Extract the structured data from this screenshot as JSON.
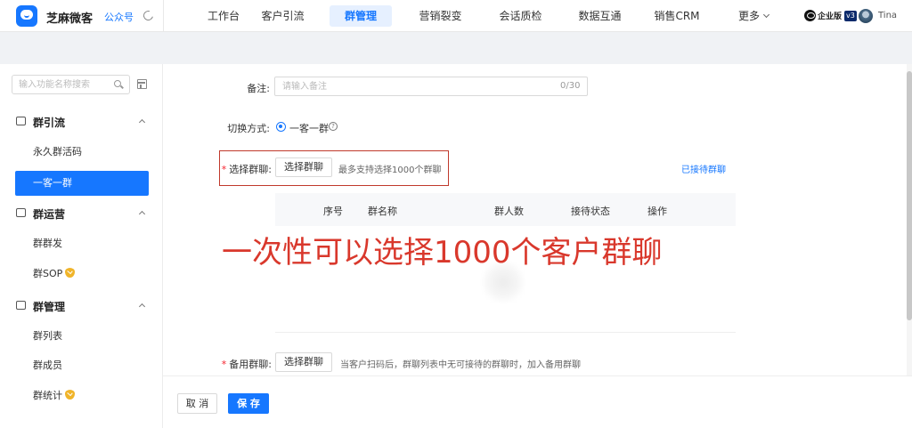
{
  "topbar": {
    "brand": "芝麻微客",
    "official_account": "公众号",
    "nav": [
      {
        "label": "工作台",
        "active": false
      },
      {
        "label": "客户引流",
        "active": false
      },
      {
        "label": "群管理",
        "active": true
      },
      {
        "label": "营销裂变",
        "active": false
      },
      {
        "label": "会话质检",
        "active": false
      },
      {
        "label": "数据互通",
        "active": false
      },
      {
        "label": "销售CRM",
        "active": false
      },
      {
        "label": "更多",
        "active": false
      }
    ],
    "edition": "企业版",
    "version": "v3",
    "username": "Tina"
  },
  "sidebar": {
    "search_placeholder": "输入功能名称搜索",
    "groups": [
      {
        "label": "群引流",
        "items": [
          {
            "label": "永久群活码",
            "active": false,
            "vip": false
          },
          {
            "label": "一客一群",
            "active": true,
            "vip": false
          }
        ]
      },
      {
        "label": "群运营",
        "items": [
          {
            "label": "群群发",
            "active": false,
            "vip": false
          },
          {
            "label": "群SOP",
            "active": false,
            "vip": true
          }
        ]
      },
      {
        "label": "群管理",
        "items": [
          {
            "label": "群列表",
            "active": false,
            "vip": false
          },
          {
            "label": "群成员",
            "active": false,
            "vip": false
          },
          {
            "label": "群统计",
            "active": false,
            "vip": true
          }
        ]
      }
    ]
  },
  "form": {
    "remark_label": "备注:",
    "remark_placeholder": "请输入备注",
    "remark_counter": "0/30",
    "switch_label": "切换方式:",
    "switch_option": "一客一群",
    "select_group_label": "选择群聊:",
    "select_group_button": "选择群聊",
    "select_group_hint": "最多支持选择1000个群聊",
    "reception_link": "已接待群聊",
    "table_headers": [
      "序号",
      "群名称",
      "群人数",
      "接待状态",
      "操作"
    ],
    "annotation": "一次性可以选择1000个客户群聊",
    "backup_label": "备用群聊:",
    "backup_button": "选择群聊",
    "backup_hint": "当客户扫码后，群聊列表中无可接待的群聊时，加入备用群聊"
  },
  "footer": {
    "cancel": "取 消",
    "save": "保 存"
  },
  "colors": {
    "accent": "#1677ff",
    "annotation": "#d9382c",
    "required": "#f5222d"
  }
}
